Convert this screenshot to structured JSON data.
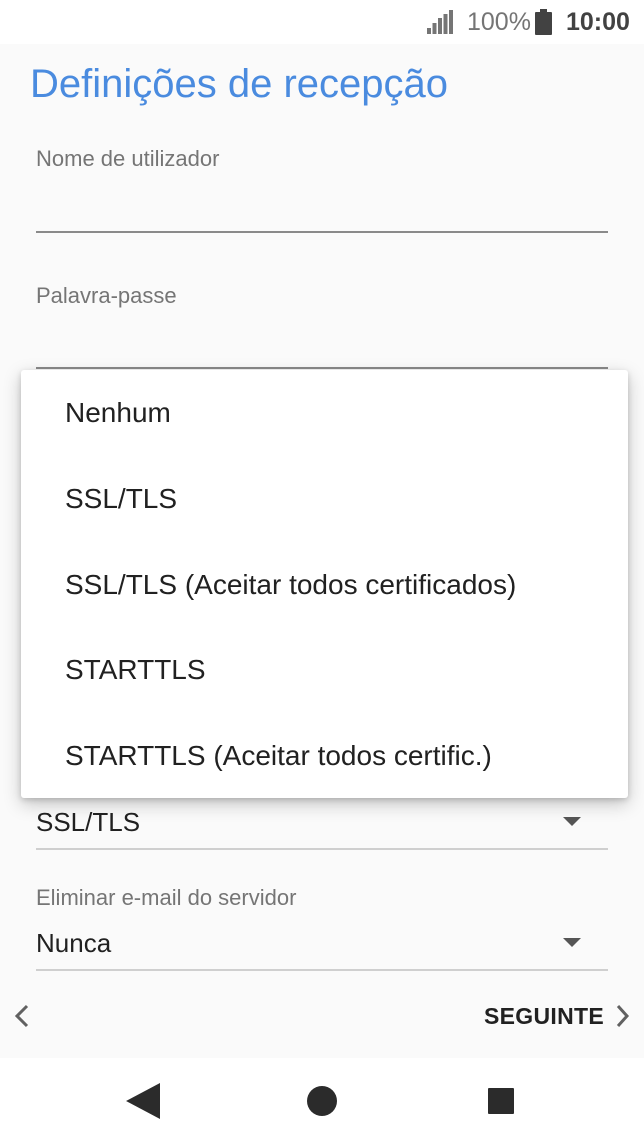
{
  "status_bar": {
    "battery_percent": "100%",
    "time": "10:00",
    "icons": [
      "signal-icon",
      "battery-icon"
    ]
  },
  "header": {
    "title": "Definições de recepção"
  },
  "form": {
    "username": {
      "label": "Nome de utilizador",
      "value": ""
    },
    "password": {
      "label": "Palavra-passe",
      "value": ""
    },
    "security_type": {
      "value": "SSL/TLS"
    },
    "delete_email": {
      "label": "Eliminar e-mail do servidor",
      "value": "Nunca"
    }
  },
  "dropdown": {
    "options": [
      "Nenhum",
      "SSL/TLS",
      "SSL/TLS (Aceitar todos certificados)",
      "STARTTLS",
      "STARTTLS (Aceitar todos certific.)"
    ]
  },
  "footer": {
    "next_label": "SEGUINTE"
  },
  "nav_bar": {
    "icons": [
      "back-triangle-icon",
      "home-circle-icon",
      "recents-square-icon"
    ]
  },
  "colors": {
    "accent": "#4a8bdf",
    "background": "#fafafa",
    "text": "#212121",
    "label": "#757575"
  }
}
